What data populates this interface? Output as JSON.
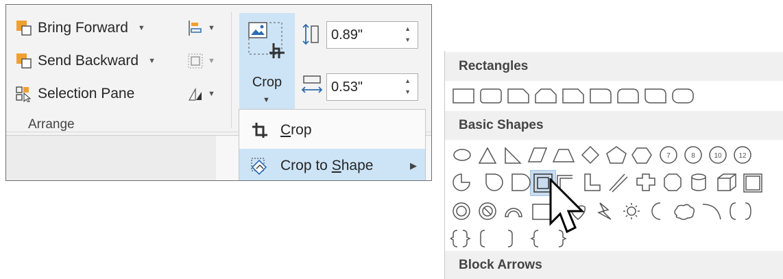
{
  "ribbon": {
    "bring_forward": "Bring Forward",
    "send_backward": "Send Backward",
    "selection_pane": "Selection Pane",
    "group_label": "Arrange",
    "crop_label": "Crop",
    "height_value": "0.89\"",
    "width_value": "0.53\""
  },
  "crop_menu": {
    "item_crop_prefix": "",
    "item_crop_u": "C",
    "item_crop_rest": "rop",
    "item_shape_prefix": "Crop to ",
    "item_shape_u": "S",
    "item_shape_rest": "hape"
  },
  "shapes_panel": {
    "categories": [
      "Rectangles",
      "Basic Shapes",
      "Block Arrows"
    ]
  },
  "colors": {
    "accent_highlight": "#cde4f7",
    "ribbon_bg": "#f3f3f3",
    "icon_orange": "#f0a030"
  },
  "icons": [
    "bring-forward-icon",
    "send-backward-icon",
    "selection-pane-icon",
    "align-icon",
    "group-icon",
    "rotate-icon",
    "crop-icon",
    "shape-height-icon",
    "shape-width-icon",
    "crop-to-shape-icon",
    "submenu-arrow-icon",
    "mouse-pointer-icon"
  ]
}
